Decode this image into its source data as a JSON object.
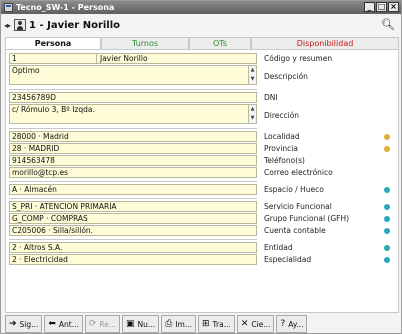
{
  "window": {
    "title": "Tecno_SW-1 - Persona",
    "buttons": [
      "_",
      "□",
      "×"
    ]
  },
  "header": {
    "nav": "◂▸",
    "title": "1 - Javier Norillo"
  },
  "tabs": [
    {
      "label": "Persona"
    },
    {
      "label": "Turnos"
    },
    {
      "label": "OTs"
    },
    {
      "label": "Disponibilidad"
    }
  ],
  "fields": {
    "codigo": "1",
    "resumen": "Javier Norillo",
    "descripcion": "Óptimo",
    "dni": "23456789D",
    "direccion": "c/ Rómulo 3, Bº Izqda.",
    "localidad": "28000 · Madrid",
    "provincia": "28 · MADRID",
    "telefono": "914563478",
    "correo": "morillo@tcp.es",
    "espacio": "A · Almacén",
    "servicio": "S_PRI · ATENCION PRIMARIA",
    "grupo": "G_COMP · COMPRAS",
    "cuenta": "C205006 · Silla/sillón.",
    "entidad": "2 · Altros S.A.",
    "especialidad": "2 · Electricidad"
  },
  "labels": {
    "codigo": "Código y resumen",
    "descripcion": "Descripción",
    "dni": "DNI",
    "direccion": "Dirección",
    "localidad": "Localidad",
    "provincia": "Provincia",
    "telefono": "Teléfono(s)",
    "correo": "Correo electrónico",
    "espacio": "Espacio / Hueco",
    "servicio": "Servicio Funcional",
    "grupo": "Grupo Funcional (GFH)",
    "cuenta": "Cuenta contable",
    "entidad": "Entidad",
    "especialidad": "Especialidad"
  },
  "toolbar": [
    {
      "label": "Sig...",
      "icon": "next-arrow-icon"
    },
    {
      "label": "Ant...",
      "icon": "prev-arrow-icon"
    },
    {
      "label": "Re...",
      "icon": "refresh-icon",
      "disabled": true
    },
    {
      "label": "Nu...",
      "icon": "new-record-icon"
    },
    {
      "label": "Im...",
      "icon": "print-icon"
    },
    {
      "label": "Tra...",
      "icon": "transfer-icon"
    },
    {
      "label": "Cie...",
      "icon": "close-x-icon"
    },
    {
      "label": "Ay...",
      "icon": "help-icon"
    }
  ],
  "colors": {
    "field_bg": "#fefcd6",
    "tab_green": "#2e8a2e",
    "tab_red": "#c01818",
    "hint_yellow": "#d8b236",
    "hint_teal": "#2aa8b8"
  }
}
